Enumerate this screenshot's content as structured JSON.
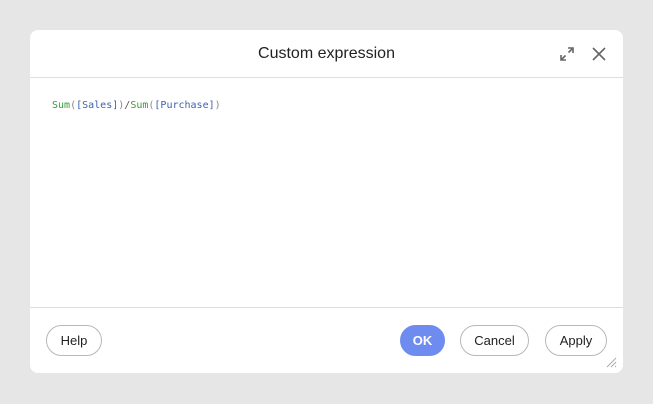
{
  "dialog": {
    "title": "Custom expression",
    "icons": {
      "expand": "expand-icon",
      "close": "close-icon",
      "resize": "resize-grip-icon"
    }
  },
  "expression": {
    "text": "Sum([Sales])/Sum([Purchase])",
    "tokens": [
      {
        "type": "fn",
        "text": "Sum"
      },
      {
        "type": "paren",
        "text": "("
      },
      {
        "type": "field",
        "text": "[Sales]"
      },
      {
        "type": "paren",
        "text": ")"
      },
      {
        "type": "op",
        "text": "/"
      },
      {
        "type": "fn",
        "text": "Sum"
      },
      {
        "type": "paren",
        "text": "("
      },
      {
        "type": "field",
        "text": "[Purchase]"
      },
      {
        "type": "paren",
        "text": ")"
      }
    ]
  },
  "footer": {
    "help_label": "Help",
    "ok_label": "OK",
    "cancel_label": "Cancel",
    "apply_label": "Apply"
  },
  "colors": {
    "background": "#e6e6e6",
    "dialog": "#ffffff",
    "accent": "#6e8cf0",
    "function_token": "#3a9a3a",
    "field_token": "#3f5fb0",
    "divider": "#dedede"
  }
}
